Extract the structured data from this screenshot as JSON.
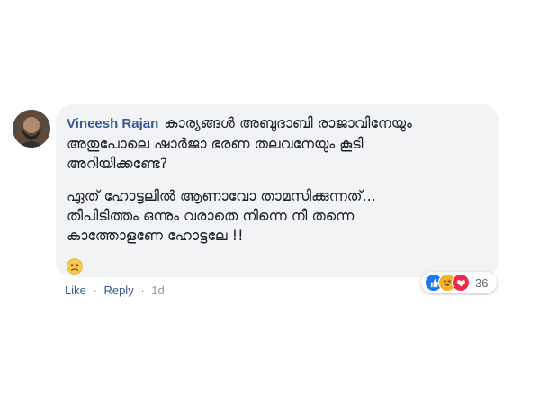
{
  "comment": {
    "author": "Vineesh Rajan",
    "lines_p1": [
      "കാര്യങ്ങൾ അബുദാബി രാജാവിനേയും",
      "അതുപോലെ ഷാർജാ ഭരണ തലവനേയും കൂടി",
      "അറിയിക്കണ്ടേ?"
    ],
    "lines_p2": [
      "ഏത് ഹോട്ടലിൽ ആണാവോ താമസിക്കുന്നത്...",
      "തീപിടിത്തം ഒന്നും വരാതെ നിന്നെ നീ തന്നെ",
      "കാത്തോളണേ ഹോട്ടലേ !!"
    ],
    "emoji_icon": "worried-face-icon"
  },
  "actions": {
    "like_label": "Like",
    "reply_label": "Reply",
    "separator": "·",
    "time": "1d"
  },
  "reactions": {
    "icons": [
      "like-icon",
      "haha-icon",
      "love-icon"
    ],
    "count": "36",
    "colors": {
      "like": "#1877f2",
      "haha": "#f7b125",
      "love": "#f0284a"
    }
  },
  "colors": {
    "bubble_bg": "#f2f3f5",
    "author": "#385898",
    "text": "#1d2129",
    "meta": "#90949c"
  }
}
